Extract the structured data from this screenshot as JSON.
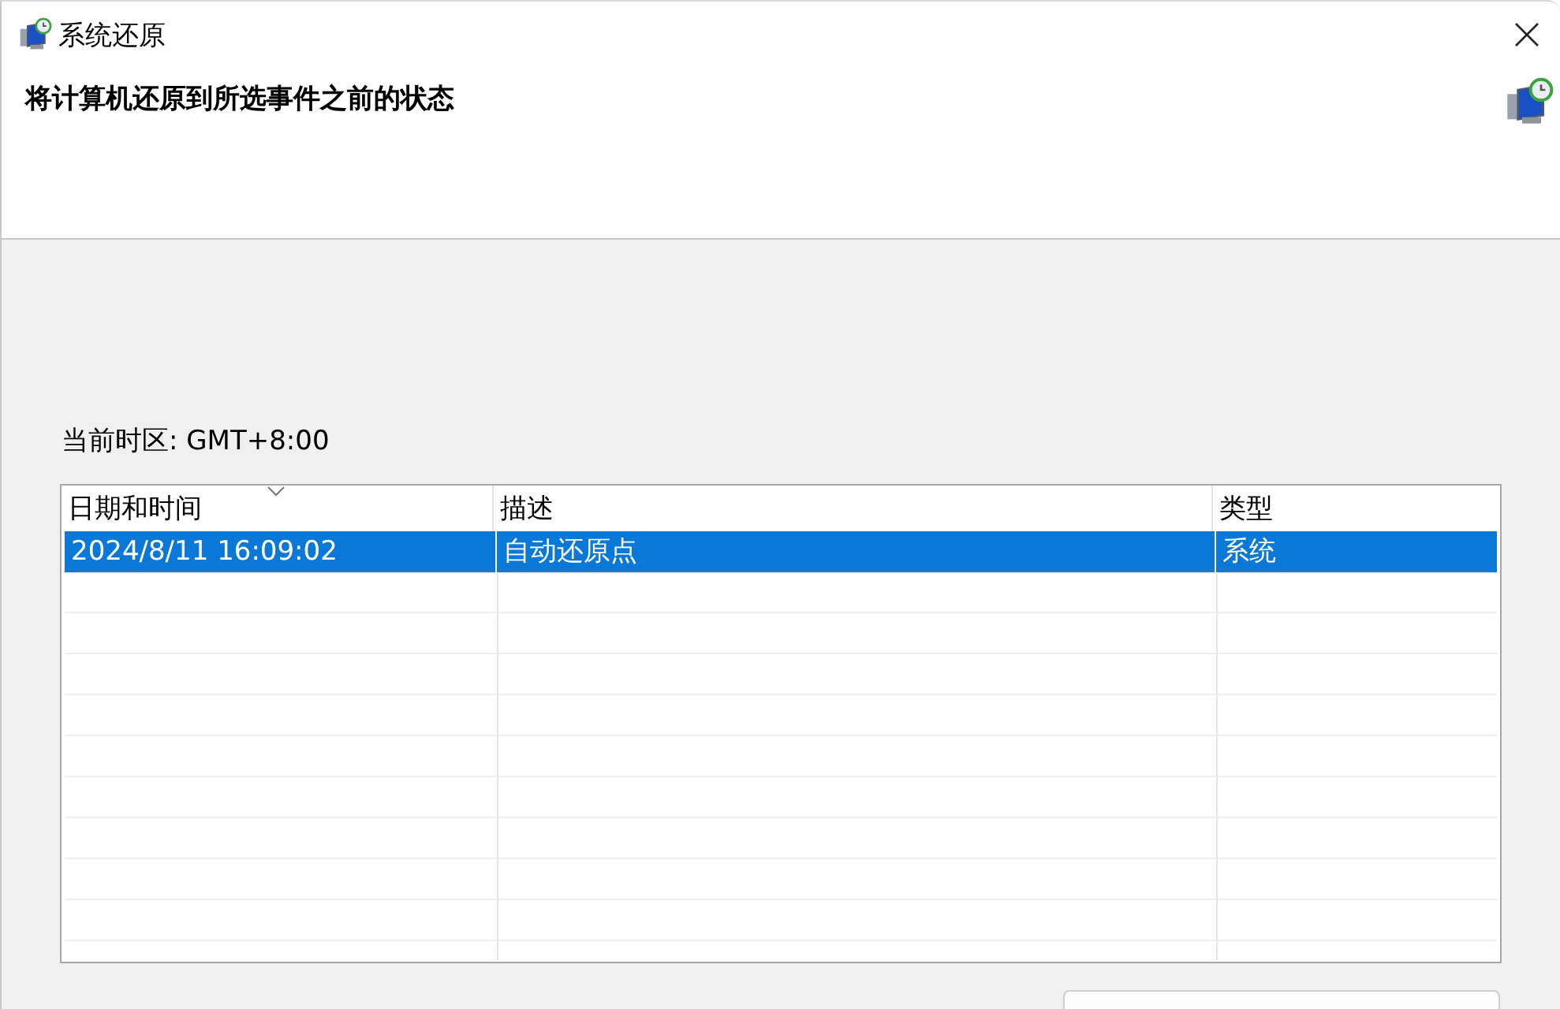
{
  "window": {
    "title": "系统还原"
  },
  "heading": "将计算机还原到所选事件之前的状态",
  "timezone": "当前时区: GMT+8:00",
  "table": {
    "columns": [
      {
        "label": "日期和时间",
        "sorted": true
      },
      {
        "label": "描述",
        "sorted": false
      },
      {
        "label": "类型",
        "sorted": false
      }
    ],
    "rows": [
      {
        "cells": [
          "2024/8/11 16:09:02",
          "自动还原点",
          "系统"
        ],
        "selected": true
      }
    ]
  }
}
